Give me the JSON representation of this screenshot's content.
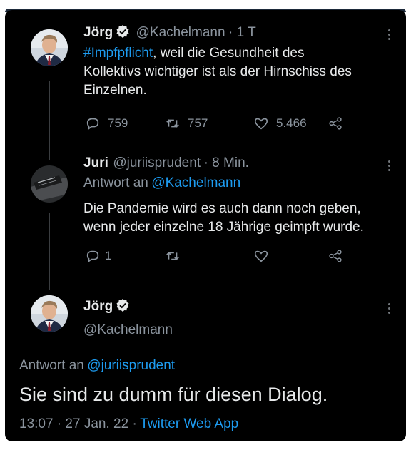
{
  "tweet1": {
    "name": "Jörg",
    "handle": "@Kachelmann",
    "time": "· 1 T",
    "hashtag": "#Impfpflicht",
    "text_line1_rest": ", weil die Gesundheit des",
    "text_line2": "Kollektivs wichtiger ist als der Hirnschiss des",
    "text_line3": "Einzelnen.",
    "replies": "759",
    "retweets": "757",
    "likes": "5.466"
  },
  "tweet2": {
    "name": "Juri",
    "handle": "@juriisprudent",
    "time": "· 8 Min.",
    "reply_prefix": "Antwort an",
    "reply_to": "@Kachelmann",
    "text_line1": "Die Pandemie wird es auch dann noch geben,",
    "text_line2": "wenn jeder einzelne 18 Jährige geimpft wurde.",
    "replies": "1"
  },
  "tweet3": {
    "name": "Jörg",
    "handle": "@Kachelmann",
    "reply_prefix": "Antwort an",
    "reply_to": "@juriisprudent",
    "text": "Sie sind zu dumm für diesen Dialog.",
    "timestamp": "13:07 · 27 Jan. 22 ·",
    "source": "Twitter Web App"
  },
  "colors": {
    "background": "#000000",
    "accent": "#1d9bf0",
    "muted": "#8b949e",
    "text": "#e7e9ea"
  }
}
